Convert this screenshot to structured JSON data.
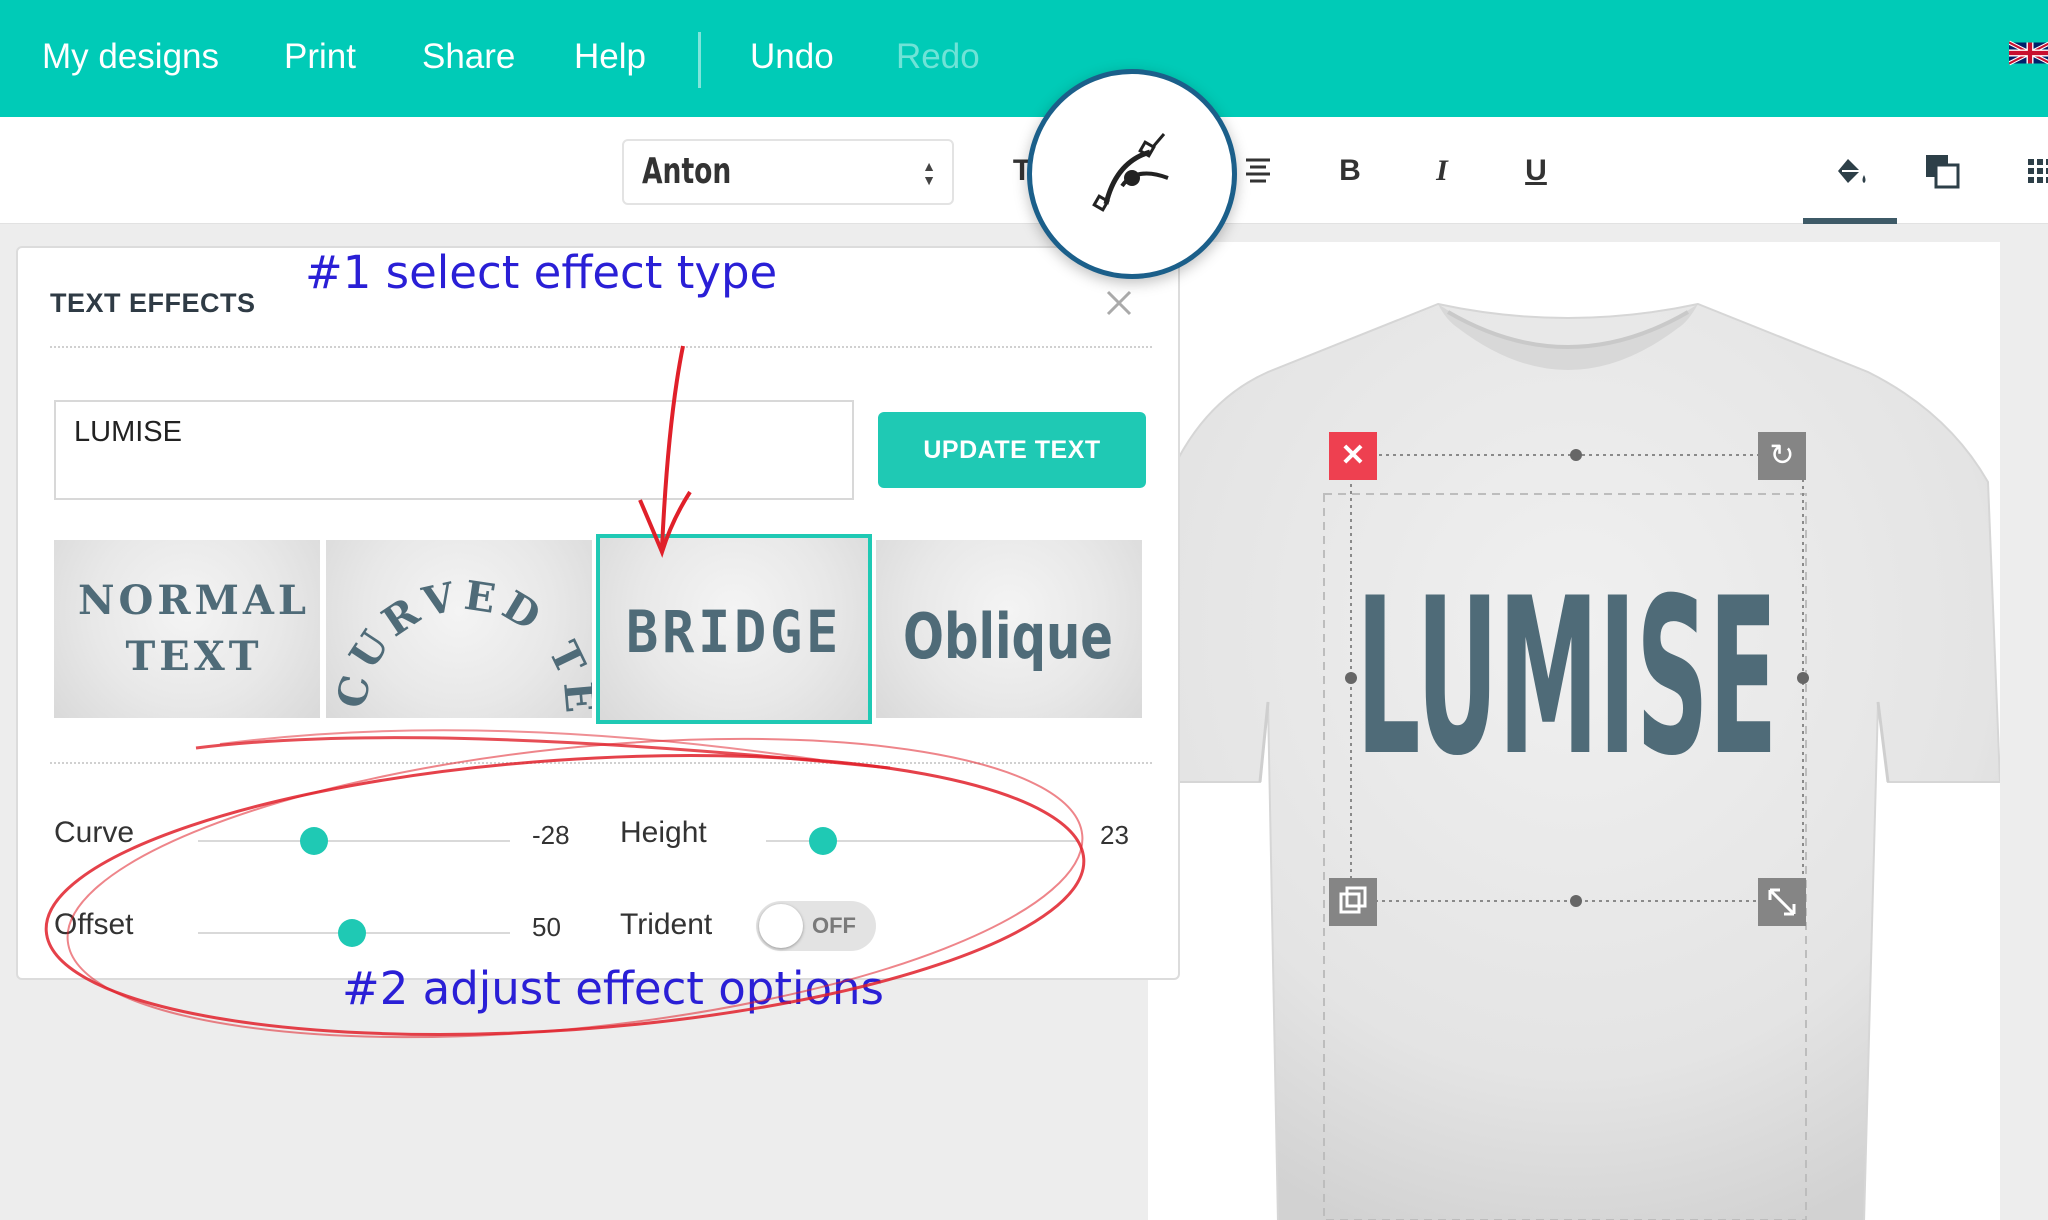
{
  "nav": {
    "items": [
      {
        "label": "My designs",
        "enabled": true
      },
      {
        "label": "Print",
        "enabled": true
      },
      {
        "label": "Share",
        "enabled": true
      },
      {
        "label": "Help",
        "enabled": true
      },
      {
        "label": "Undo",
        "enabled": true
      },
      {
        "label": "Redo",
        "enabled": false
      }
    ],
    "language_flag": "uk-flag-icon"
  },
  "toolbar": {
    "font_family": "Anton",
    "text_effect_icon": "curve-path-icon",
    "buttons": {
      "text_transform": "T",
      "align": "align-center-icon",
      "bold": "B",
      "italic": "I",
      "underline": "U",
      "fill": "paint-bucket-icon",
      "layers": "layers-icon",
      "grid": "grid-icon"
    }
  },
  "panel": {
    "title": "TEXT EFFECTS",
    "text_value": "LUMISE",
    "update_button": "UPDATE TEXT",
    "effects": [
      {
        "name": "normal",
        "label_line1": "NORMAL",
        "label_line2": "TEXT",
        "selected": false
      },
      {
        "name": "curved",
        "label": "CURVED TEXT",
        "selected": false
      },
      {
        "name": "bridge",
        "label": "BRIDGE",
        "selected": true
      },
      {
        "name": "oblique",
        "label": "Oblique",
        "selected": false
      }
    ],
    "options": {
      "curve": {
        "label": "Curve",
        "value": "-28",
        "position": 0.37
      },
      "offset": {
        "label": "Offset",
        "value": "50",
        "position": 0.5
      },
      "height": {
        "label": "Height",
        "value": "23",
        "position": 0.18
      },
      "trident": {
        "label": "Trident",
        "state": "OFF"
      }
    }
  },
  "canvas": {
    "design_text": "LUMISE",
    "text_color": "#4f6b78",
    "shirt_color": "#e8e8e8"
  },
  "annotations": {
    "step1": "#1 select effect type",
    "step2": "#2 adjust effect options"
  },
  "colors": {
    "accent": "#00cbb7",
    "annotation": "#2a1fd6",
    "arrow": "#e0202a"
  }
}
